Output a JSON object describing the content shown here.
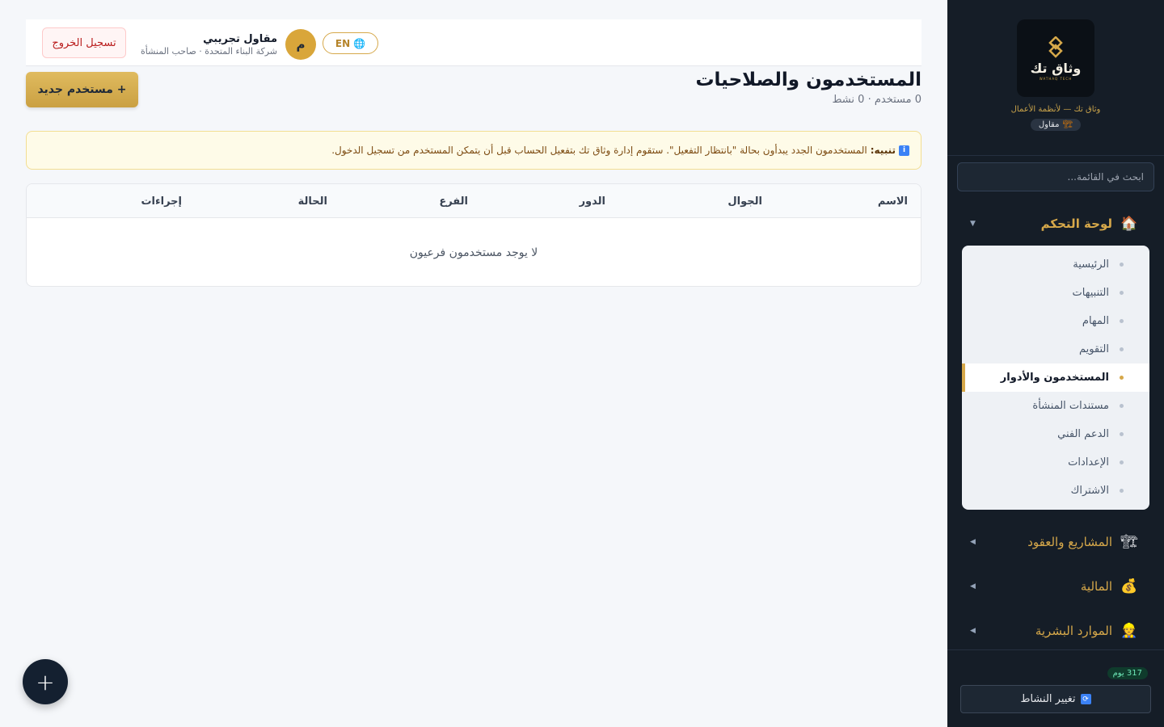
{
  "brand": {
    "logo_text": "وثاق تك",
    "logo_subtext": "WATHAQ TECH",
    "tagline": "وثاق تك — لأنظمة الأعمال",
    "role_chip": "مقاول"
  },
  "sidebar": {
    "search_placeholder": "ابحث في القائمة...",
    "groups": [
      {
        "label": "لوحة التحكم",
        "icon": "house-icon",
        "expanded": true,
        "items": [
          {
            "label": "الرئيسية"
          },
          {
            "label": "التنبيهات"
          },
          {
            "label": "المهام"
          },
          {
            "label": "التقويم"
          },
          {
            "label": "المستخدمون والأدوار",
            "active": true
          },
          {
            "label": "مستندات المنشأة"
          },
          {
            "label": "الدعم الفني"
          },
          {
            "label": "الإعدادات"
          },
          {
            "label": "الاشتراك"
          }
        ]
      },
      {
        "label": "المشاريع والعقود",
        "icon": "crane-icon",
        "expanded": false
      },
      {
        "label": "المالية",
        "icon": "money-bag-icon",
        "expanded": false
      },
      {
        "label": "الموارد البشرية",
        "icon": "person-icon",
        "expanded": false
      }
    ],
    "days_badge": "317 يوم",
    "switch_label": "تغيير النشاط"
  },
  "topbar": {
    "logout_label": "تسجيل الخروج",
    "user_name": "مقاول تجريبي",
    "user_sub": "شركة البناء المتحدة · صاحب المنشأة",
    "avatar_letter": "م",
    "lang_label": "EN"
  },
  "page": {
    "title": "المستخدمون والصلاحيات",
    "subtitle": "0 مستخدم · 0 نشط",
    "new_user_label": "+ مستخدم جديد"
  },
  "notice": {
    "lead": "تنبيه:",
    "text": "المستخدمون الجدد يبدأون بحالة \"بانتظار التفعيل\". ستقوم إدارة وثاق تك بتفعيل الحساب قبل أن يتمكن المستخدم من تسجيل الدخول."
  },
  "table": {
    "columns": [
      "الاسم",
      "الجوال",
      "الدور",
      "الفرع",
      "الحالة",
      "إجراءات"
    ],
    "empty_text": "لا يوجد مستخدمون فرعيون"
  },
  "fab_label": "+",
  "colors": {
    "accent": "#d6a84a",
    "sidebar_bg": "#151d27",
    "danger": "#b91c1c"
  }
}
